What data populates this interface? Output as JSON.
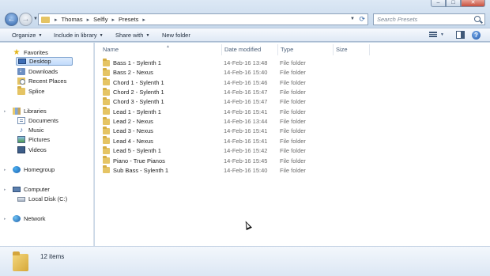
{
  "titlebar": {
    "minimize_glyph": "–",
    "maximize_glyph": "□",
    "close_glyph": "✕"
  },
  "navigation": {
    "back_glyph": "←",
    "forward_glyph": "→",
    "dropdown_glyph": "▼"
  },
  "address": {
    "separator": "▸",
    "breadcrumbs": [
      "Thomas",
      "Selfly",
      "Presets"
    ],
    "dropdown_glyph": "▼",
    "refresh_glyph": "⟳"
  },
  "search": {
    "placeholder": "Search Presets"
  },
  "toolbar": {
    "organize": "Organize",
    "include_in_library": "Include in library",
    "share_with": "Share with",
    "new_folder": "New folder",
    "caret": "▼",
    "help_glyph": "?"
  },
  "sidebar": {
    "expand_glyph": "▸",
    "favorites": {
      "label": "Favorites",
      "items": [
        "Desktop",
        "Downloads",
        "Recent Places",
        "Splice"
      ]
    },
    "libraries": {
      "label": "Libraries",
      "items": [
        "Documents",
        "Music",
        "Pictures",
        "Videos"
      ]
    },
    "homegroup": "Homegroup",
    "computer": {
      "label": "Computer",
      "items": [
        "Local Disk (C:)"
      ]
    },
    "network": "Network",
    "selected": "Desktop"
  },
  "columns": {
    "name": "Name",
    "date_modified": "Date modified",
    "type": "Type",
    "size": "Size",
    "sort_glyph": "▲"
  },
  "files": [
    {
      "name": "Bass 1 - Sylenth 1",
      "date": "14-Feb-16 13:48",
      "type": "File folder"
    },
    {
      "name": "Bass 2 - Nexus",
      "date": "14-Feb-16 15:40",
      "type": "File folder"
    },
    {
      "name": "Chord 1 - Sylenth 1",
      "date": "14-Feb-16 15:46",
      "type": "File folder"
    },
    {
      "name": "Chord 2 - Sylenth 1",
      "date": "14-Feb-16 15:47",
      "type": "File folder"
    },
    {
      "name": "Chord 3 - Sylenth 1",
      "date": "14-Feb-16 15:47",
      "type": "File folder"
    },
    {
      "name": "Lead 1 - Sylenth 1",
      "date": "14-Feb-16 15:41",
      "type": "File folder"
    },
    {
      "name": "Lead 2 - Nexus",
      "date": "14-Feb-16 13:44",
      "type": "File folder"
    },
    {
      "name": "Lead 3 - Nexus",
      "date": "14-Feb-16 15:41",
      "type": "File folder"
    },
    {
      "name": "Lead 4 - Nexus",
      "date": "14-Feb-16 15:41",
      "type": "File folder"
    },
    {
      "name": "Lead 5 - Sylenth 1",
      "date": "14-Feb-16 15:42",
      "type": "File folder"
    },
    {
      "name": "Piano - True Pianos",
      "date": "14-Feb-16 15:45",
      "type": "File folder"
    },
    {
      "name": "Sub Bass - Sylenth 1",
      "date": "14-Feb-16 15:40",
      "type": "File folder"
    }
  ],
  "status": {
    "item_count": "12 items"
  },
  "colors": {
    "accent": "#2e62a8",
    "folder": "#e5c464",
    "selection": "#c1dbfc"
  }
}
